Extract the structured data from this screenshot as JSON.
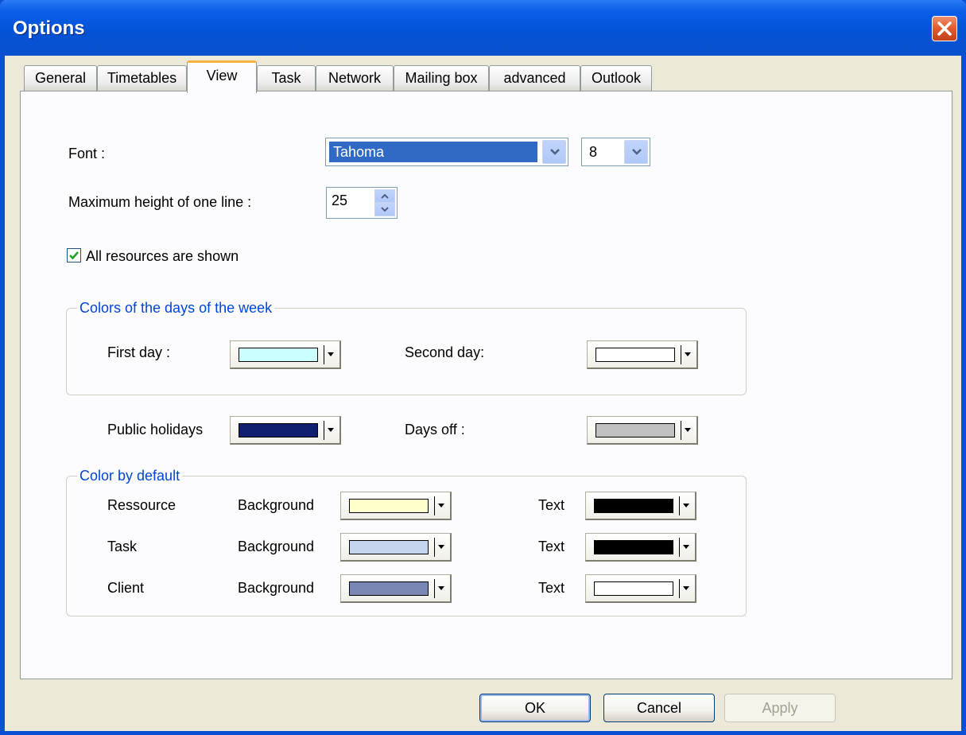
{
  "window": {
    "title": "Options"
  },
  "tabs": [
    {
      "label": "General"
    },
    {
      "label": "Timetables"
    },
    {
      "label": "View"
    },
    {
      "label": "Task"
    },
    {
      "label": "Network"
    },
    {
      "label": "Mailing box"
    },
    {
      "label": "advanced"
    },
    {
      "label": "Outlook"
    }
  ],
  "view": {
    "font_label": "Font :",
    "font_value": "Tahoma",
    "font_size_value": "8",
    "max_height_label": "Maximum height of one line :",
    "max_height_value": "25",
    "all_resources_label": "All resources are shown",
    "all_resources_checked": true,
    "days_group": {
      "title": "Colors of the days of the week",
      "first_day_label": "First day :",
      "first_day_color": "#ccffff",
      "second_day_label": "Second day:",
      "second_day_color": "#ffffff"
    },
    "public_holidays_label": "Public holidays",
    "public_holidays_color": "#0f1e6e",
    "days_off_label": "Days off :",
    "days_off_color": "#c0c0c0",
    "default_group": {
      "title": "Color by default",
      "rows": [
        {
          "name": "Ressource",
          "bg_label": "Background",
          "bg_color": "#ffffcc",
          "text_label": "Text",
          "text_color": "#000000"
        },
        {
          "name": "Task",
          "bg_label": "Background",
          "bg_color": "#c4d4ec",
          "text_label": "Text",
          "text_color": "#000000"
        },
        {
          "name": "Client",
          "bg_label": "Background",
          "bg_color": "#7a86b4",
          "text_label": "Text",
          "text_color": "#ffffff"
        }
      ]
    }
  },
  "buttons": {
    "ok": "OK",
    "cancel": "Cancel",
    "apply": "Apply"
  }
}
